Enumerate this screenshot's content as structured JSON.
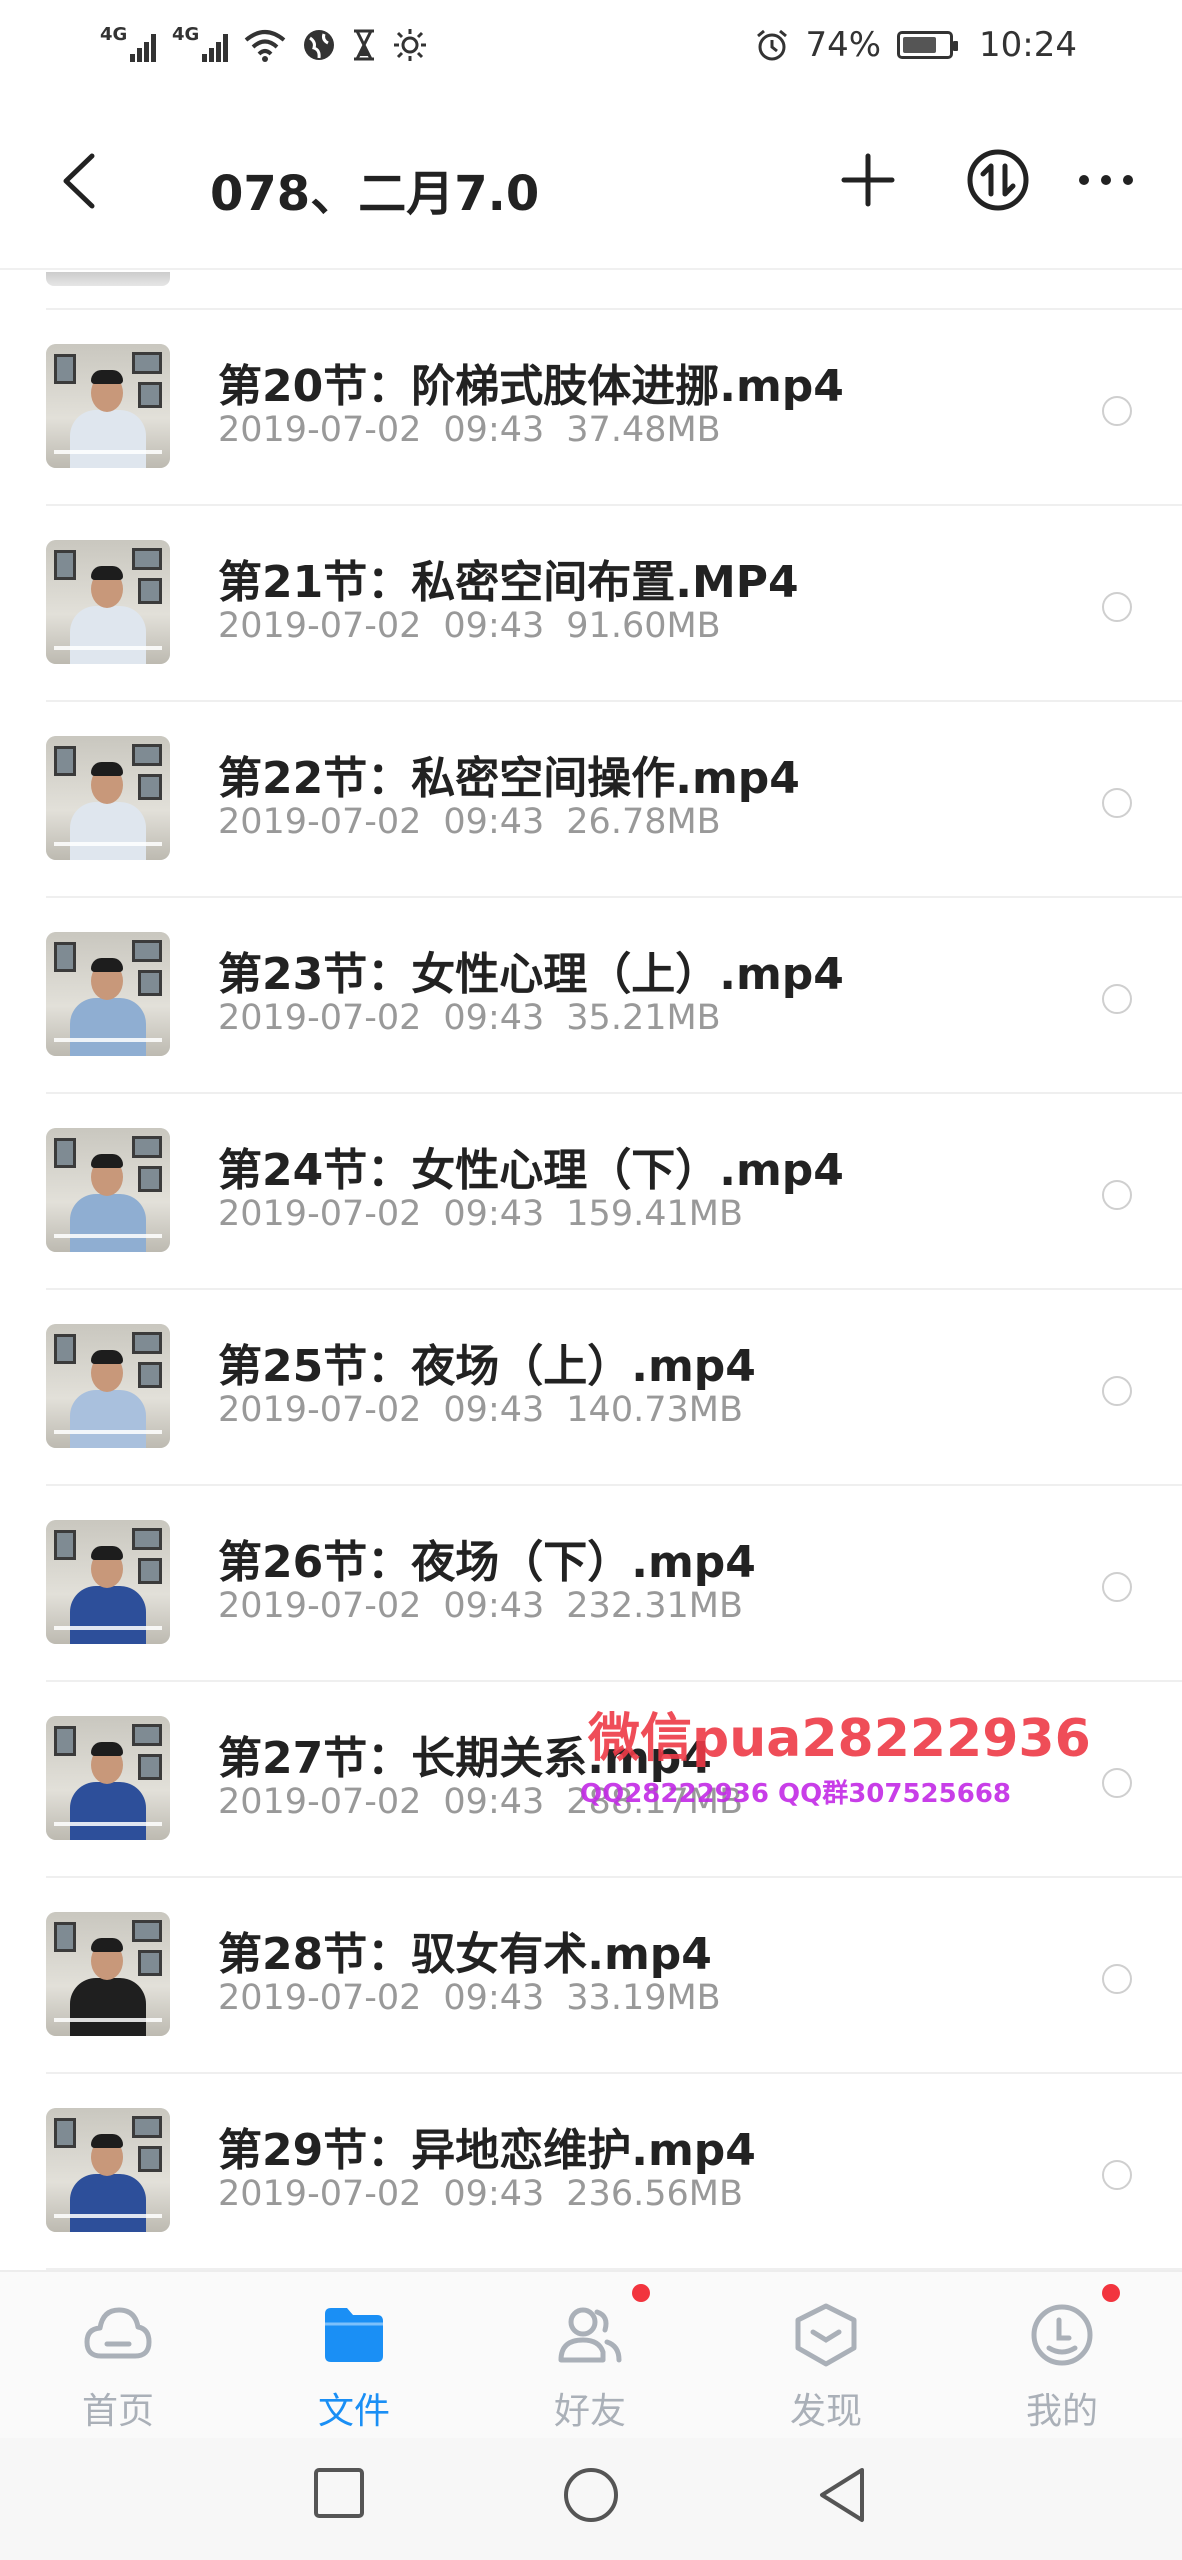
{
  "status_bar": {
    "network_1": "4G",
    "network_2": "4G",
    "battery_percent": "74%",
    "battery_level": 0.74,
    "time": "10:24",
    "icons": [
      "signal-icon",
      "signal-icon",
      "wifi-icon",
      "globe-icon",
      "hourglass-icon",
      "brightness-icon",
      "alarm-icon",
      "battery-icon"
    ]
  },
  "header": {
    "title": "078、二月7.0",
    "icons": [
      "back-icon",
      "add-icon",
      "sort-icon",
      "more-icon"
    ]
  },
  "files": [
    {
      "name": "第20节：阶梯式肢体进挪.mp4",
      "date": "2019-07-02",
      "time": "09:43",
      "size": "37.48MB",
      "shirt": "#dfe6ee"
    },
    {
      "name": "第21节：私密空间布置.MP4",
      "date": "2019-07-02",
      "time": "09:43",
      "size": "91.60MB",
      "shirt": "#dfe6ee"
    },
    {
      "name": "第22节：私密空间操作.mp4",
      "date": "2019-07-02",
      "time": "09:43",
      "size": "26.78MB",
      "shirt": "#dfe6ee"
    },
    {
      "name": "第23节：女性心理（上）.mp4",
      "date": "2019-07-02",
      "time": "09:43",
      "size": "35.21MB",
      "shirt": "#8faed2"
    },
    {
      "name": "第24节：女性心理（下）.mp4",
      "date": "2019-07-02",
      "time": "09:43",
      "size": "159.41MB",
      "shirt": "#8faed2"
    },
    {
      "name": "第25节：夜场（上）.mp4",
      "date": "2019-07-02",
      "time": "09:43",
      "size": "140.73MB",
      "shirt": "#a9c0dd"
    },
    {
      "name": "第26节：夜场（下）.mp4",
      "date": "2019-07-02",
      "time": "09:43",
      "size": "232.31MB",
      "shirt": "#2d4f9a"
    },
    {
      "name": "第27节：长期关系.mp4",
      "date": "2019-07-02",
      "time": "09:43",
      "size": "288.17MB",
      "shirt": "#2d4f9a"
    },
    {
      "name": "第28节：驭女有术.mp4",
      "date": "2019-07-02",
      "time": "09:43",
      "size": "33.19MB",
      "shirt": "#1f1f1f"
    },
    {
      "name": "第29节：异地恋维护.mp4",
      "date": "2019-07-02",
      "time": "09:43",
      "size": "236.56MB",
      "shirt": "#2d4f9a"
    }
  ],
  "watermark": {
    "main": "微信pua28222936",
    "sub": "QQ28222936 QQ群307525668"
  },
  "bottom_nav": {
    "items": [
      {
        "label": "首页",
        "icon": "cloud-icon",
        "active": false,
        "badge": false
      },
      {
        "label": "文件",
        "icon": "folder-icon",
        "active": true,
        "badge": false
      },
      {
        "label": "好友",
        "icon": "friends-icon",
        "active": false,
        "badge": true
      },
      {
        "label": "发现",
        "icon": "discover-icon",
        "active": false,
        "badge": false
      },
      {
        "label": "我的",
        "icon": "profile-icon",
        "active": false,
        "badge": true
      }
    ]
  },
  "system_nav": {
    "icons": [
      "recent-apps-icon",
      "home-icon",
      "back-nav-icon"
    ]
  },
  "colors": {
    "accent": "#1a8ff5",
    "inactive": "#aab0b8",
    "badge": "#f2343e",
    "meta_text": "#999999"
  }
}
